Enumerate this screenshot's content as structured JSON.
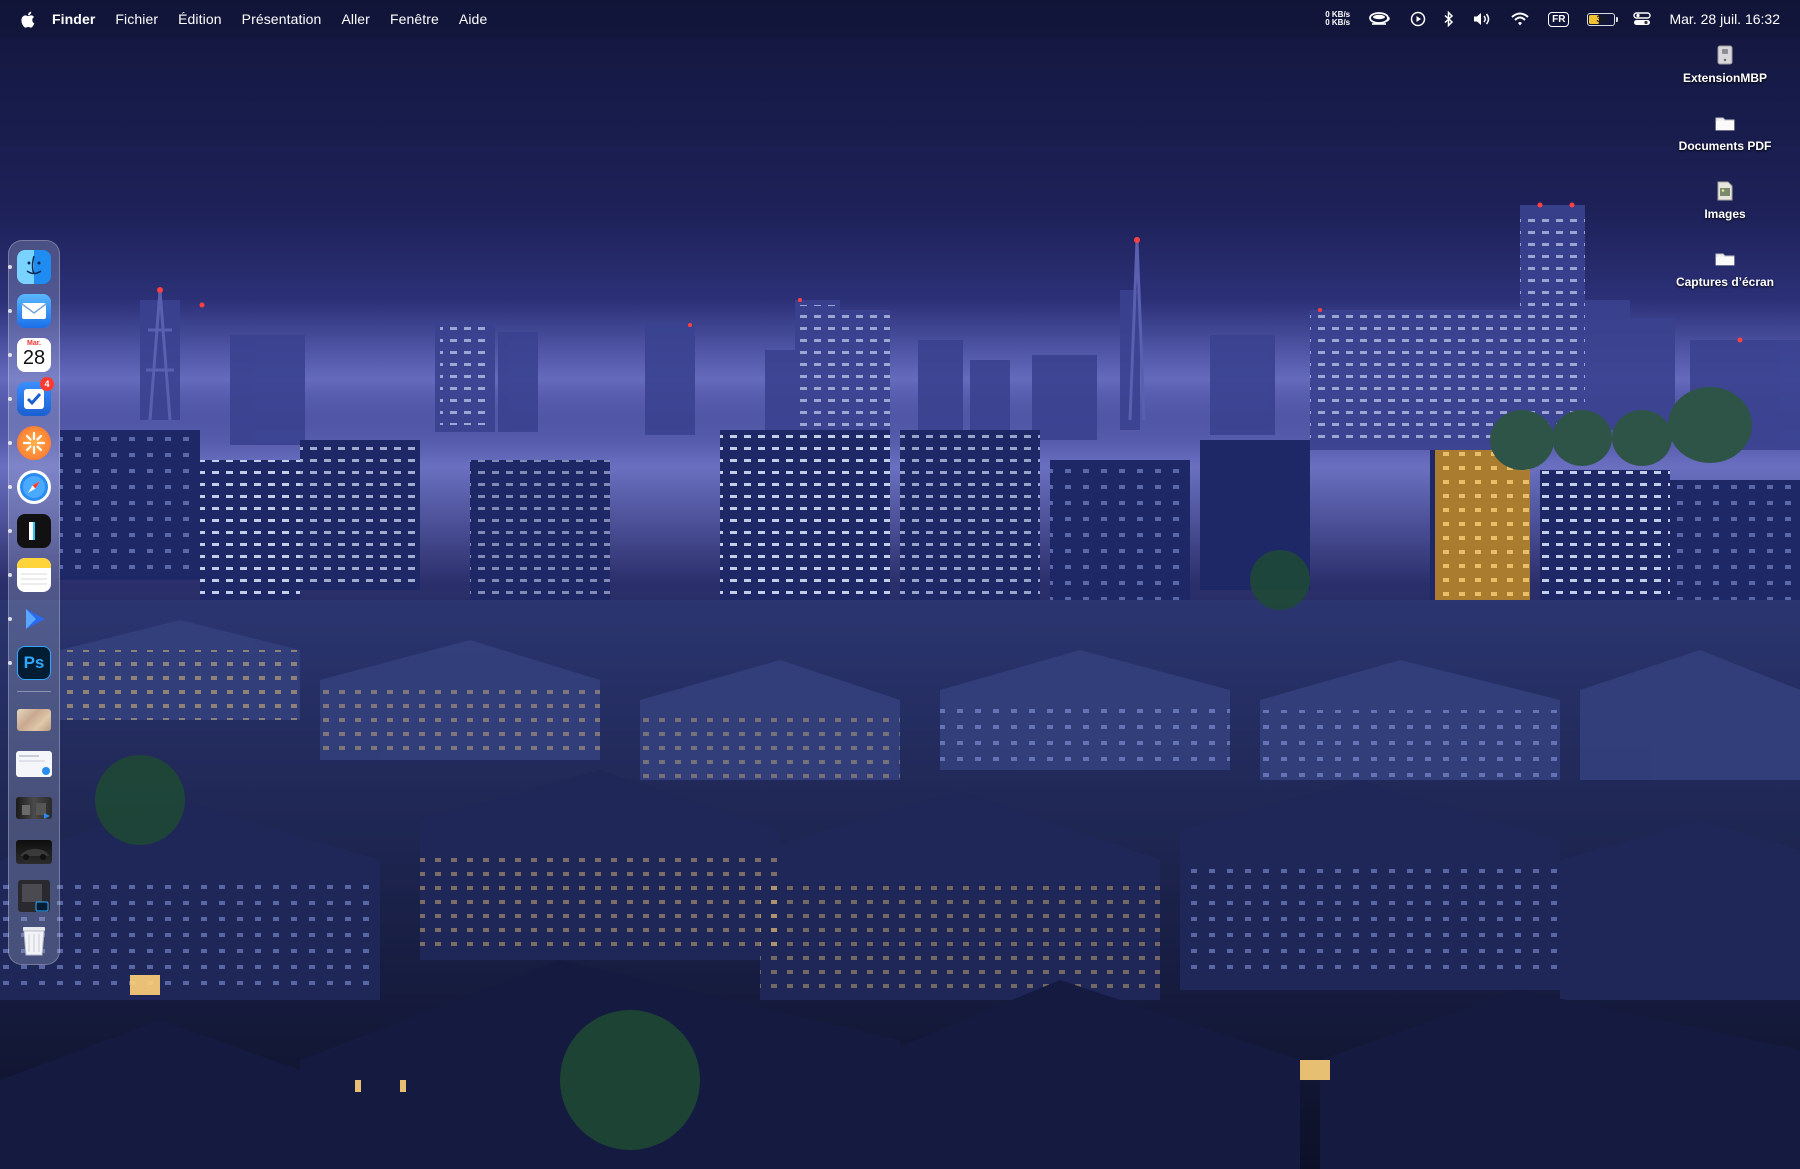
{
  "menubar": {
    "apple_icon": "apple-icon",
    "app_name": "Finder",
    "menus": [
      "Fichier",
      "Édition",
      "Présentation",
      "Aller",
      "Fenêtre",
      "Aide"
    ],
    "status": {
      "net_up": "0 KB/s",
      "net_down": "0 KB/s",
      "keyboard_layout": "FR",
      "battery_percent": "35",
      "battery_level": 0.35,
      "clock": "Mar. 28 juil.  16:32"
    },
    "status_icons": [
      "coffee-cup-icon",
      "play-circle-icon",
      "bluetooth-icon",
      "volume-icon",
      "wifi-icon",
      "control-center-icon"
    ]
  },
  "desktop": {
    "icons": [
      {
        "label": "ExtensionMBP",
        "icon": "drive-icon"
      },
      {
        "label": "Documents PDF",
        "icon": "folder-icon"
      },
      {
        "label": "Images",
        "icon": "image-file-icon"
      },
      {
        "label": "Captures d’écran",
        "icon": "screenshot-folder-icon"
      }
    ]
  },
  "dock": {
    "apps": [
      {
        "name": "Finder",
        "icon": "finder-icon",
        "running": true
      },
      {
        "name": "Mail",
        "icon": "mail-icon",
        "running": true
      },
      {
        "name": "Calendrier",
        "icon": "calendar-icon",
        "running": true,
        "month": "Mar.",
        "day": "28"
      },
      {
        "name": "Rappels",
        "icon": "reminders-icon",
        "running": true,
        "badge": "4"
      },
      {
        "name": "Spark",
        "icon": "sunburst-icon",
        "running": true
      },
      {
        "name": "Safari",
        "icon": "safari-compass-icon",
        "running": true
      },
      {
        "name": "iA Writer",
        "icon": "writer-cursor-icon",
        "running": true
      },
      {
        "name": "Notes",
        "icon": "notes-icon",
        "running": true
      },
      {
        "name": "Infuse",
        "icon": "play-arrow-icon",
        "running": true
      },
      {
        "name": "Photoshop",
        "icon": "photoshop-icon",
        "running": true,
        "label": "Ps"
      }
    ],
    "recent": [
      {
        "name": "image-1",
        "icon": "image-thumbnail-icon"
      },
      {
        "name": "document-1",
        "icon": "document-thumbnail-icon"
      },
      {
        "name": "video-1",
        "icon": "video-thumbnail-icon"
      },
      {
        "name": "video-2",
        "icon": "video-thumbnail-icon"
      },
      {
        "name": "psd-1",
        "icon": "psd-thumbnail-icon",
        "label": "Ps"
      },
      {
        "name": "Corbeille",
        "icon": "trash-icon"
      }
    ]
  },
  "colors": {
    "sky_top": "#0f1236",
    "sky_mid": "#2a2f78",
    "horizon": "#5b62b8",
    "accent_red": "#ff3b30",
    "window_warm": "#ffd27a",
    "window_cool": "#dfe9ff"
  }
}
